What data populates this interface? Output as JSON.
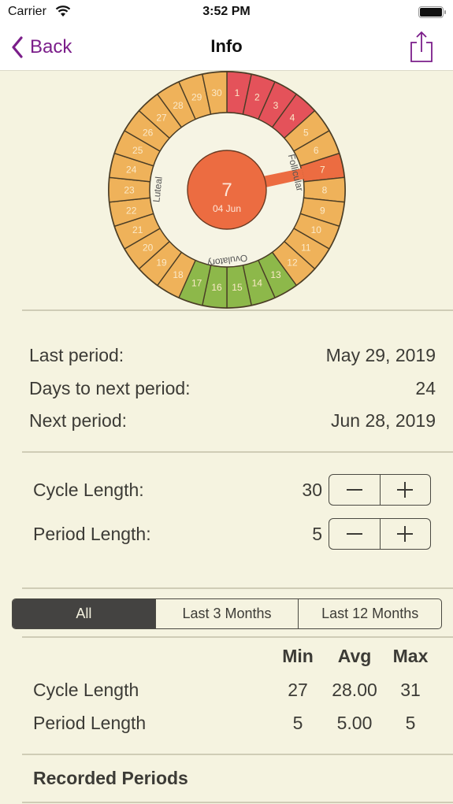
{
  "status_bar": {
    "carrier": "Carrier",
    "time": "3:52 PM",
    "wifi_icon": "wifi-icon",
    "battery_icon": "battery-icon"
  },
  "nav": {
    "back_label": "Back",
    "title": "Info",
    "back_icon": "chevron-left-icon",
    "share_icon": "share-icon",
    "accent_color": "#7b1e8a"
  },
  "cycle_wheel": {
    "days": 30,
    "current_day": "7",
    "current_date": "04 Jun",
    "phase_labels": {
      "follicular": "Follicular",
      "ovulatory": "Ovulatory",
      "luteal": "Luteal"
    },
    "period_days": [
      1,
      2,
      3,
      4
    ],
    "ovulatory_days": [
      13,
      14,
      15,
      16,
      17
    ],
    "highlight_day": 7,
    "colors": {
      "period": "#e4525a",
      "ovulatory": "#8db84a",
      "default": "#efb25a",
      "current": "#ec6c41",
      "inner": "#f6f4e4"
    }
  },
  "summary": {
    "rows": [
      {
        "label": "Last period:",
        "value": "May 29, 2019"
      },
      {
        "label": "Days to next period:",
        "value": "24"
      },
      {
        "label": "Next period:",
        "value": "Jun 28, 2019"
      }
    ]
  },
  "settings": {
    "cycle_length": {
      "label": "Cycle Length:",
      "value": "30"
    },
    "period_length": {
      "label": "Period Length:",
      "value": "5"
    },
    "minus_icon": "minus-icon",
    "plus_icon": "plus-icon"
  },
  "range_filter": {
    "options": [
      "All",
      "Last 3 Months",
      "Last 12 Months"
    ],
    "selected": "All"
  },
  "stats": {
    "headers": [
      "Min",
      "Avg",
      "Max"
    ],
    "rows": [
      {
        "label": "Cycle Length",
        "min": "27",
        "avg": "28.00",
        "max": "31"
      },
      {
        "label": "Period Length",
        "min": "5",
        "avg": "5.00",
        "max": "5"
      }
    ]
  },
  "recorded_periods": {
    "title": "Recorded Periods"
  }
}
